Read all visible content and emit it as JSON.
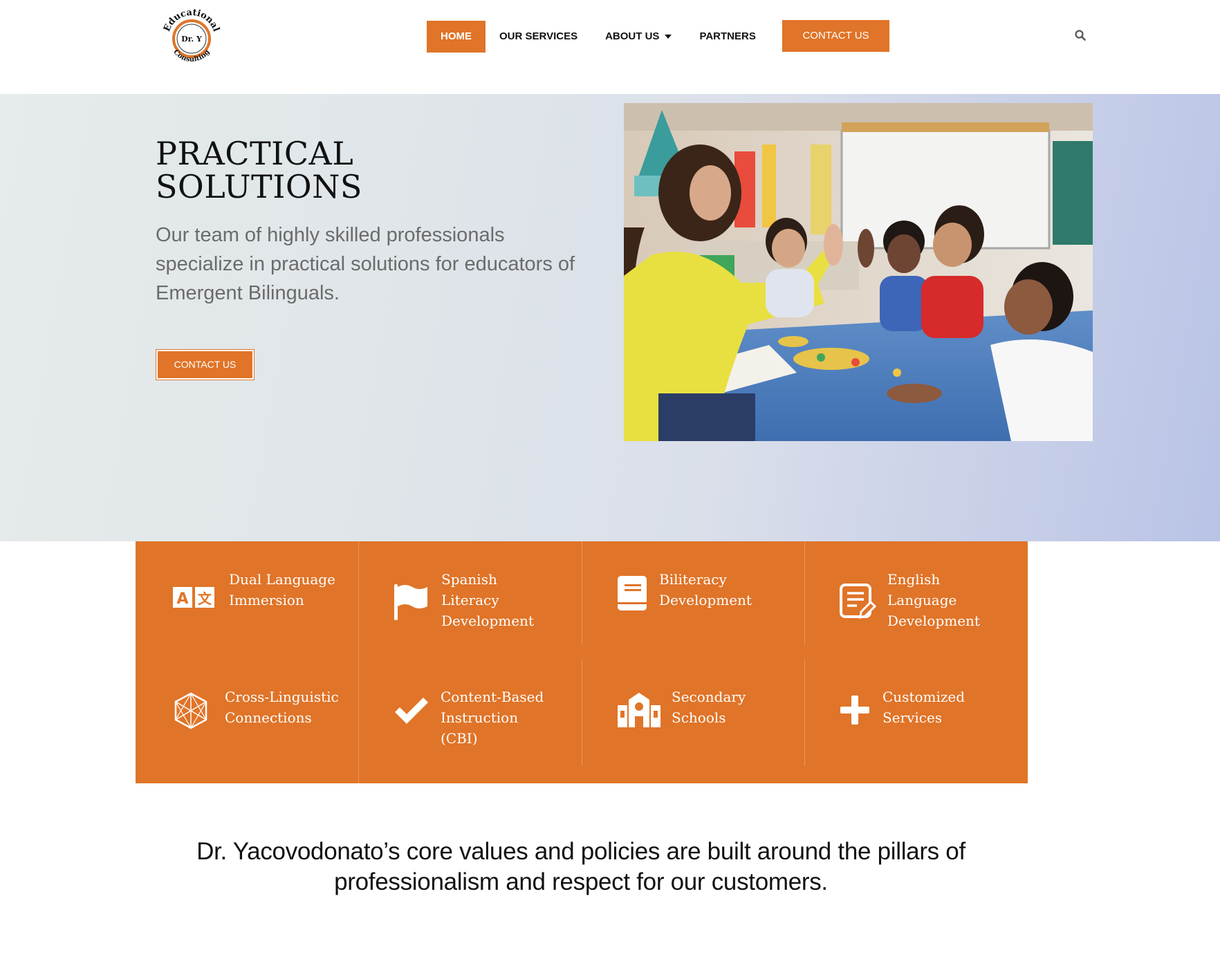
{
  "header": {
    "logo": {
      "top_text": "Educational",
      "center_text": "Dr. Y",
      "bottom_text": "Consulting"
    },
    "nav": [
      {
        "label": "HOME",
        "active": true
      },
      {
        "label": "OUR SERVICES",
        "active": false
      },
      {
        "label": "ABOUT US",
        "active": false,
        "has_dropdown": true
      },
      {
        "label": "PARTNERS",
        "active": false
      }
    ],
    "contact_label": "CONTACT US",
    "search_icon": "search-icon"
  },
  "hero": {
    "title_line1": "PRACTICAL",
    "title_line2": "SOLUTIONS",
    "subtitle": "Our team of highly skilled professionals specialize in practical solutions for educators of Emergent Bilinguals.",
    "button_label": "CONTACT US",
    "image": "classroom-photo"
  },
  "services": [
    {
      "label": "Dual Language Immersion",
      "icon": "translate-icon"
    },
    {
      "label": "Spanish Literacy Development",
      "icon": "flag-icon"
    },
    {
      "label": "Biliteracy Development",
      "icon": "book-icon"
    },
    {
      "label": "English Language Development",
      "icon": "document-edit-icon"
    },
    {
      "label": "Cross-Linguistic Connections",
      "icon": "network-icon"
    },
    {
      "label": "Content-Based Instruction (CBI)",
      "icon": "check-icon"
    },
    {
      "label": "Secondary Schools",
      "icon": "school-icon"
    },
    {
      "label": "Customized Services",
      "icon": "plus-icon"
    }
  ],
  "values_text": "Dr. Yacovodonato’s core values and policies are built around the pillars of professionalism and respect for our customers.",
  "colors": {
    "accent": "#e07428",
    "text": "#111111",
    "subtitle": "#6b6b6b"
  }
}
